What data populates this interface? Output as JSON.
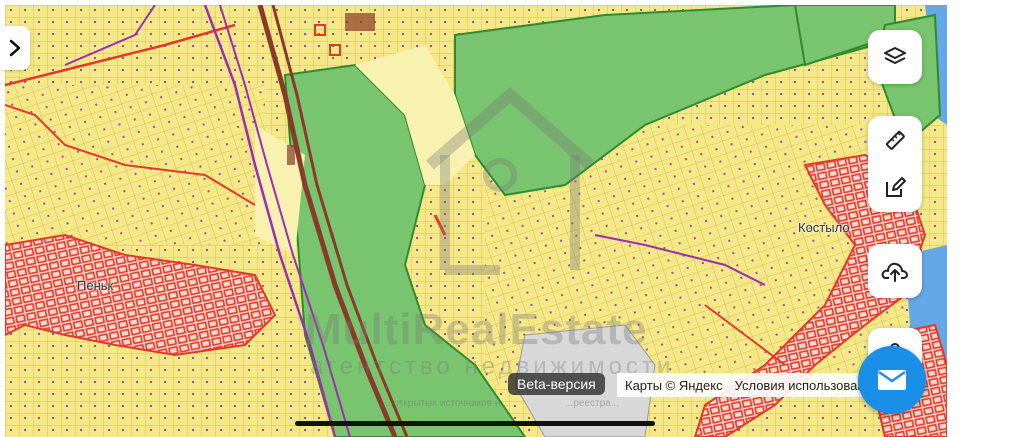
{
  "map": {
    "place_labels": [
      "Пеньк",
      "Костыло"
    ],
    "watermark": {
      "brand": "MultiRealEstate",
      "tagline": "агентство недвижимости"
    },
    "beta_label": "Beta-версия",
    "attribution": {
      "provider": "Карты © Яндекс",
      "terms": "Условия использования"
    },
    "disclaimer_fragments": [
      "...открытых источников и...",
      "...реестра..."
    ]
  },
  "controls": {
    "expand_icon": "chevron-right-icon",
    "layers_icon": "layers-icon",
    "ruler_icon": "ruler-icon",
    "edit_icon": "edit-icon",
    "upload_icon": "upload-icon",
    "share_icon": "share-icon",
    "mail_icon": "mail-icon"
  },
  "colors": {
    "residential": "#f3ea86",
    "forest": "#79c46e",
    "parcel_border": "#e23a2a",
    "railway": "#8a3a2a",
    "water": "#64a8e8",
    "industrial": "#d8d8d8",
    "accent": "#1a8fe8"
  }
}
